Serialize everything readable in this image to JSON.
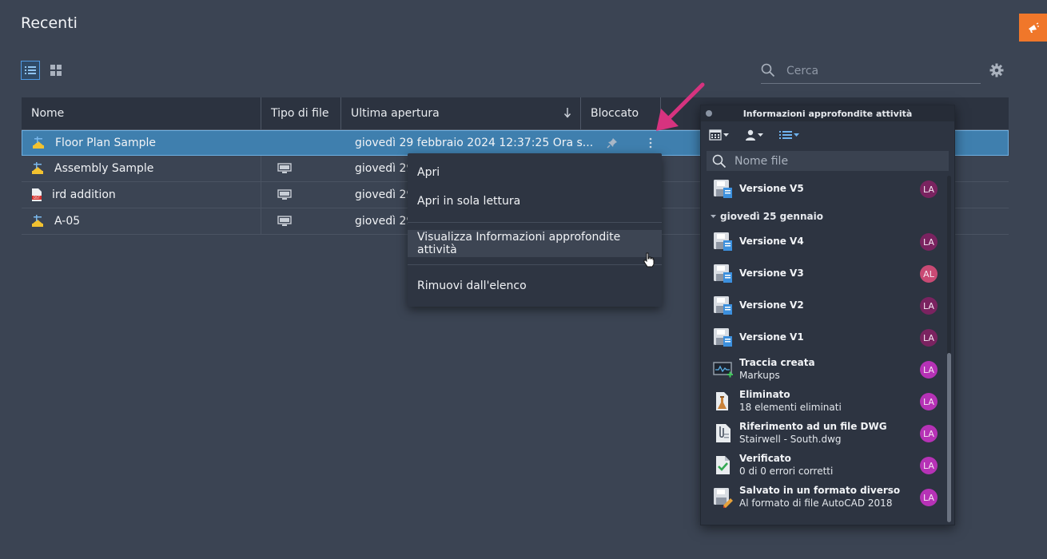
{
  "page": {
    "title": "Recenti"
  },
  "search": {
    "placeholder": "Cerca"
  },
  "table": {
    "columns": {
      "name": "Nome",
      "type": "Tipo di file",
      "opened": "Ultima apertura",
      "locked": "Bloccato"
    },
    "rows": [
      {
        "name": "Floor Plan Sample",
        "date": "giovedì 29 febbraio 2024 12:37:25 Ora s...",
        "icon": "dwg-file-icon",
        "type_icon": "",
        "selected": true
      },
      {
        "name": "Assembly Sample",
        "date": "giovedì 29",
        "icon": "dwg-file-icon",
        "type_icon": "monitor-icon"
      },
      {
        "name": "ird addition",
        "date": "giovedì 29",
        "icon": "dst-file-icon",
        "type_icon": "monitor-icon"
      },
      {
        "name": "A-05",
        "date": "giovedì 29",
        "icon": "dwg-file-icon",
        "type_icon": "monitor-icon"
      }
    ]
  },
  "menu": {
    "open": "Apri",
    "open_readonly": "Apri in sola lettura",
    "insights": "Visualizza Informazioni approfondite attività",
    "remove": "Rimuovi dall'elenco"
  },
  "panel": {
    "title": "Informazioni approfondite attività",
    "filter_placeholder": "Nome file",
    "group": "giovedì 25 gennaio",
    "items": [
      {
        "title": "Versione V5",
        "sub": "",
        "icon": "save-version-icon",
        "avatar": "LA",
        "avatar_color": "#7a2360"
      },
      {
        "title": "Versione V4",
        "sub": "",
        "icon": "save-version-icon",
        "avatar": "LA",
        "avatar_color": "#7a2360"
      },
      {
        "title": "Versione V3",
        "sub": "",
        "icon": "save-version-icon",
        "avatar": "AL",
        "avatar_color": "#c94a74"
      },
      {
        "title": "Versione V2",
        "sub": "",
        "icon": "save-version-icon",
        "avatar": "LA",
        "avatar_color": "#7a2360"
      },
      {
        "title": "Versione V1",
        "sub": "",
        "icon": "save-version-icon",
        "avatar": "LA",
        "avatar_color": "#7a2360"
      },
      {
        "title": "Traccia creata",
        "sub": "Markups",
        "icon": "trace-created-icon",
        "avatar": "LA",
        "avatar_color": "#b632b6"
      },
      {
        "title": "Eliminato",
        "sub": "18 elementi eliminati",
        "icon": "purge-icon",
        "avatar": "LA",
        "avatar_color": "#b632b6"
      },
      {
        "title": "Riferimento ad un file DWG",
        "sub": "Stairwell - South.dwg",
        "icon": "xref-attach-icon",
        "avatar": "LA",
        "avatar_color": "#b632b6"
      },
      {
        "title": "Verificato",
        "sub": "0 di 0 errori corretti",
        "icon": "audit-check-icon",
        "avatar": "LA",
        "avatar_color": "#b632b6"
      },
      {
        "title": "Salvato in un formato diverso",
        "sub": "Al formato di file AutoCAD 2018",
        "icon": "save-as-format-icon",
        "avatar": "LA",
        "avatar_color": "#b632b6"
      }
    ]
  },
  "colors": {
    "accent": "#3f7fae",
    "arrow": "#d6337f",
    "corner": "#f0772a"
  }
}
